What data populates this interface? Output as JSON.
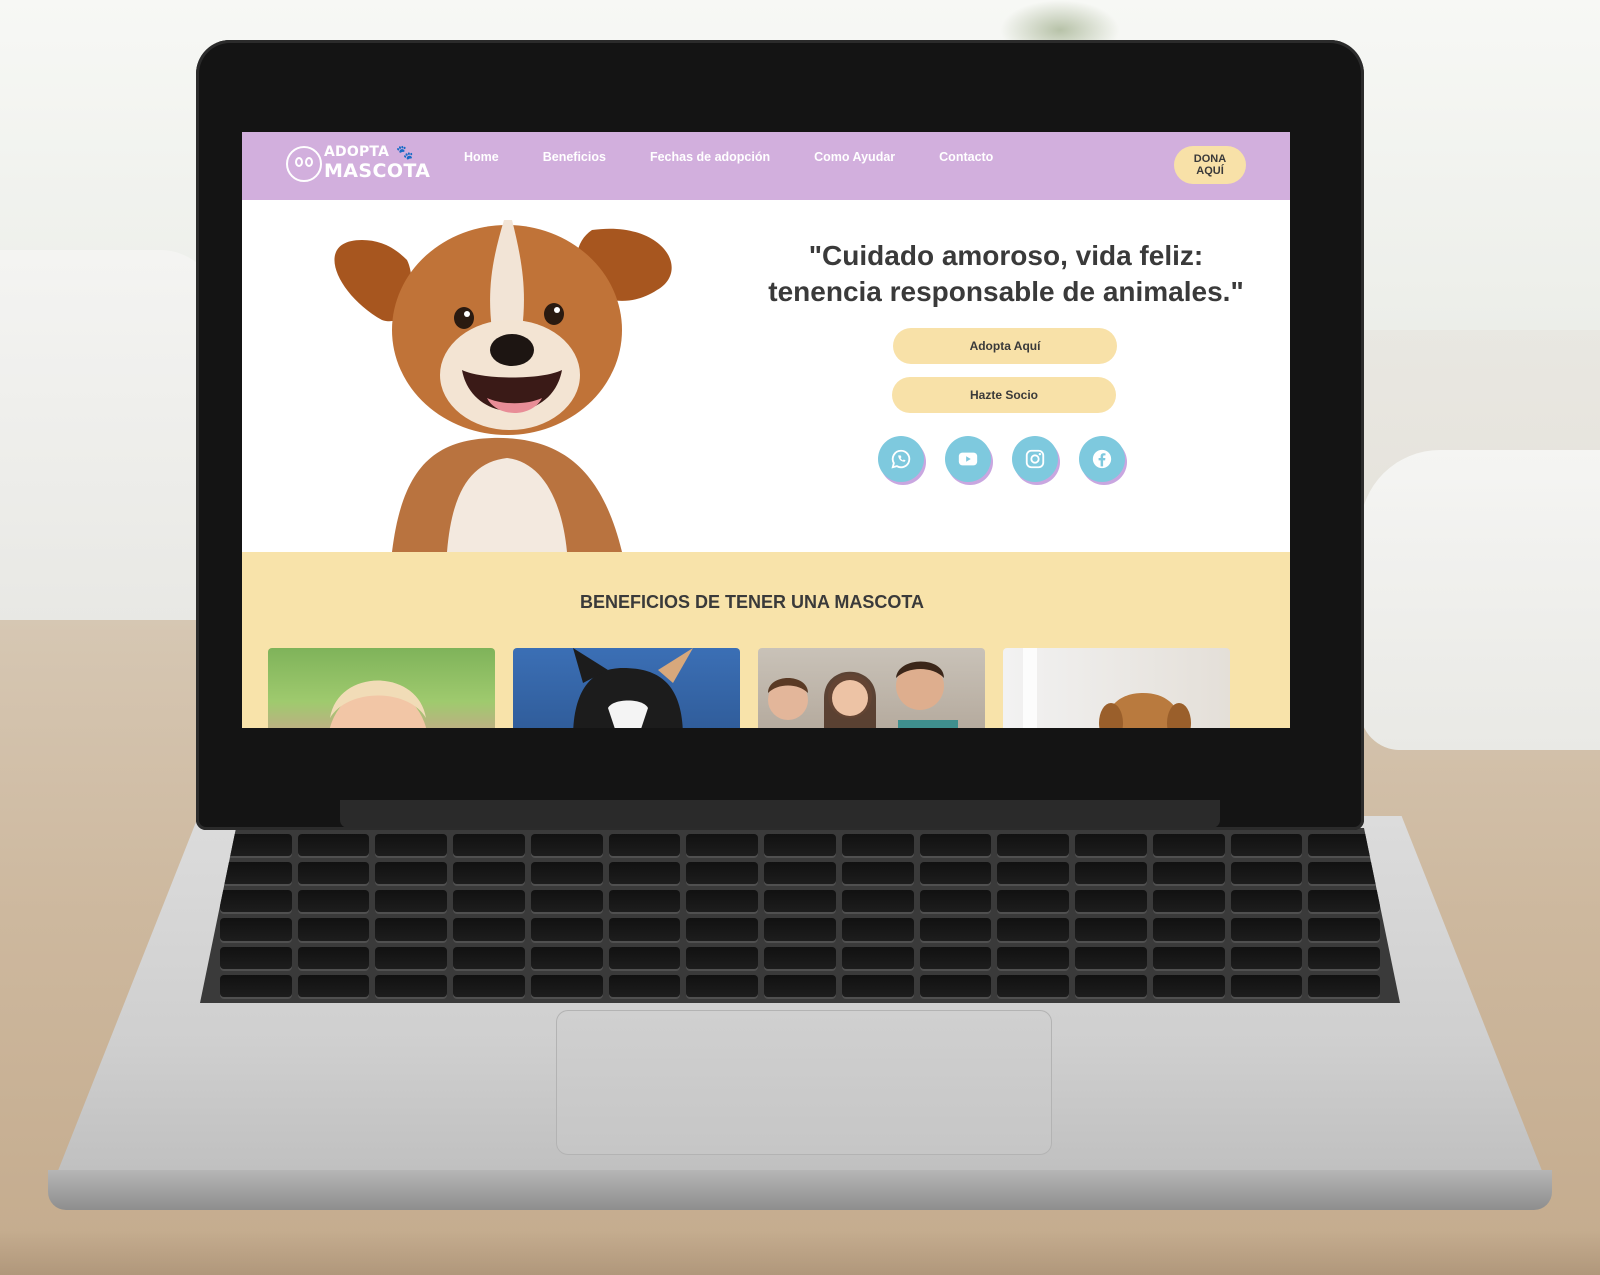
{
  "site": {
    "logo": {
      "line1": "ADOPTA",
      "line2": "MASCOTA"
    },
    "nav": [
      {
        "label": "Home"
      },
      {
        "label": "Beneficios"
      },
      {
        "label": "Fechas de adopción"
      },
      {
        "label": "Como Ayudar"
      },
      {
        "label": "Contacto"
      }
    ],
    "donate_label": "DONA AQUÍ"
  },
  "hero": {
    "title": "\"Cuidado amoroso, vida feliz: tenencia responsable de animales.\"",
    "buttons": {
      "adopt": "Adopta Aquí",
      "socio": "Hazte Socio"
    },
    "socials": [
      "whatsapp-icon",
      "youtube-icon",
      "instagram-icon",
      "facebook-icon"
    ]
  },
  "benefits": {
    "title": "BENEFICIOS DE TENER UNA MASCOTA"
  },
  "colors": {
    "nav": "#d2afdd",
    "accent": "#f8e1a8",
    "social": "#7ec9de",
    "section": "#f8e3aa"
  }
}
